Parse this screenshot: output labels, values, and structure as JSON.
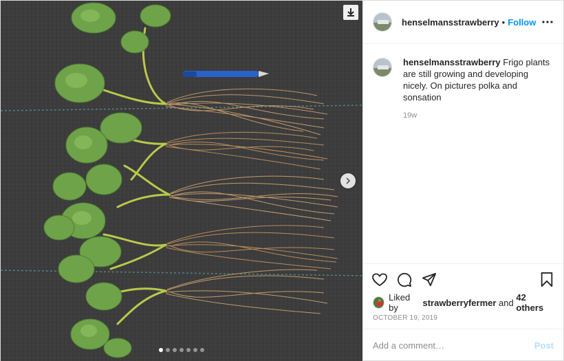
{
  "post": {
    "author": "henselmansstrawberry",
    "separator": "•",
    "follow_label": "Follow",
    "more_icon": "more-options-icon"
  },
  "caption": {
    "username": "henselmansstrawberry",
    "text": "Frigo plants are still growing and developing nicely. On pictures polka and sonsation",
    "time_ago": "19w"
  },
  "media": {
    "download_icon": "download-icon",
    "next_icon": "chevron-right-icon",
    "slide_count": 7,
    "active_slide": 1
  },
  "actions": {
    "icons": [
      "heart-icon",
      "comment-icon",
      "share-icon",
      "bookmark-icon"
    ]
  },
  "likes": {
    "prefix": "Liked by",
    "liker": "strawberryfermer",
    "connector": "and",
    "others": "42 others"
  },
  "date": "October 19, 2019",
  "comment_box": {
    "placeholder": "Add a comment…",
    "post_label": "Post"
  },
  "colors": {
    "link_blue": "#0095f6",
    "post_disabled": "#b2dffc",
    "muted": "#8e8e8e"
  }
}
